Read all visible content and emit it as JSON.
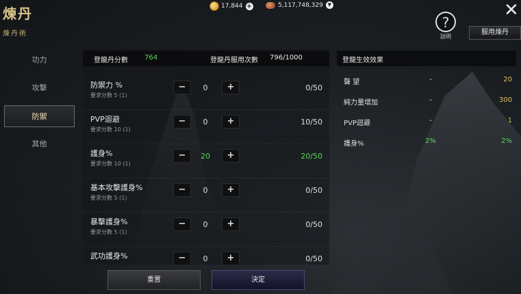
{
  "header": {
    "title": "煉丹",
    "subtitle": "煉丹術",
    "gold": "17,844",
    "silver": "5,117,748,329",
    "help_label": "說明",
    "use_button": "服用煉丹",
    "close_icon": "close-icon"
  },
  "sidebar": {
    "items": [
      {
        "label": "功力"
      },
      {
        "label": "攻擊"
      },
      {
        "label": "防禦"
      },
      {
        "label": "其他"
      }
    ],
    "active": "防禦"
  },
  "stats": {
    "score_label": "登龍丹分數",
    "score_value": "764",
    "uses_label": "登龍丹服用次數",
    "uses_value": "796/1000"
  },
  "rows": [
    {
      "name": "防禦力 %",
      "req": "要求分數 5 (1)",
      "value": "0",
      "cap": "0/50"
    },
    {
      "name": "PVP迴避",
      "req": "要求分數 10 (1)",
      "value": "0",
      "cap": "10/50"
    },
    {
      "name": "護身%",
      "req": "要求分數 10 (1)",
      "value": "20",
      "cap": "20/50"
    },
    {
      "name": "基本攻擊護身%",
      "req": "要求分數 5 (1)",
      "value": "0",
      "cap": "0/50"
    },
    {
      "name": "暴擊護身%",
      "req": "要求分數 5 (1)",
      "value": "0",
      "cap": "0/50"
    },
    {
      "name": "武功護身%",
      "req": "",
      "value": "0",
      "cap": "0/50"
    }
  ],
  "buttons": {
    "reset": "重置",
    "confirm": "決定"
  },
  "effects": {
    "title": "登龍生效效果",
    "items": [
      {
        "name": "聲 望",
        "base": "-",
        "value": "20"
      },
      {
        "name": "純力量增加",
        "base": "-",
        "value": "300"
      },
      {
        "name": "PVP迴避",
        "base": "-",
        "value": "1"
      },
      {
        "name": "護身%",
        "base": "2%",
        "value": "2%"
      }
    ]
  },
  "colors": {
    "accent_green": "#5fd45f",
    "gold_text": "#e0c060",
    "title_gold": "#d9c38a"
  }
}
